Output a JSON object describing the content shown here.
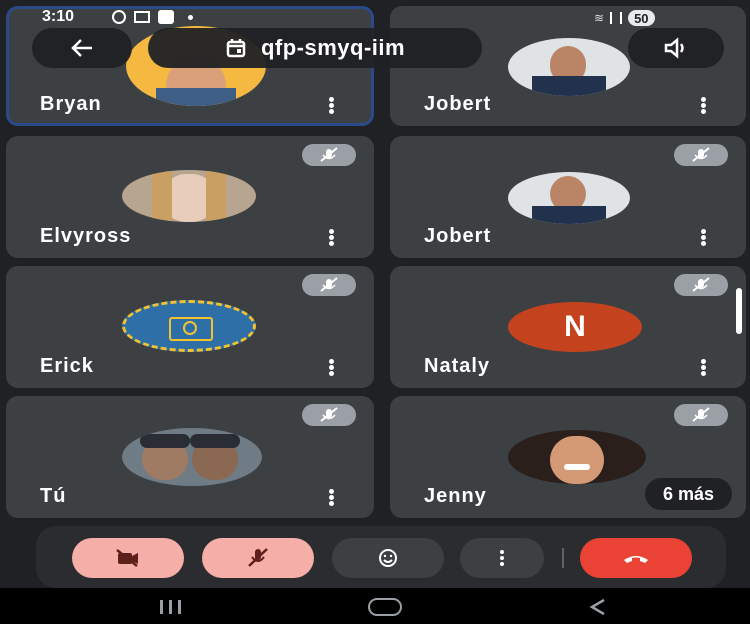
{
  "status": {
    "time": "3:10",
    "battery": "50"
  },
  "meeting": {
    "code": "qfp-smyq-iim"
  },
  "participants": [
    {
      "name": "Bryan",
      "muted": false
    },
    {
      "name": "Jobert",
      "muted": false
    },
    {
      "name": "Elvyross",
      "muted": true
    },
    {
      "name": "Jobert",
      "muted": true
    },
    {
      "name": "Erick",
      "muted": true
    },
    {
      "name": "Nataly",
      "muted": true,
      "initial": "N"
    },
    {
      "name": "Tú",
      "muted": true
    },
    {
      "name": "Jenny",
      "muted": true
    }
  ],
  "more_participants": "6 más",
  "colors": {
    "background": "#202124",
    "tile": "#3c4043",
    "hangup": "#ea4335",
    "pink": "#f6aea9",
    "avatar_n": "#c5421e"
  },
  "icons": [
    "back-arrow-icon",
    "calendar-icon",
    "speaker-icon",
    "camera-off-icon",
    "mic-off-icon",
    "emoji-icon",
    "more-vert-icon",
    "hangup-icon"
  ]
}
